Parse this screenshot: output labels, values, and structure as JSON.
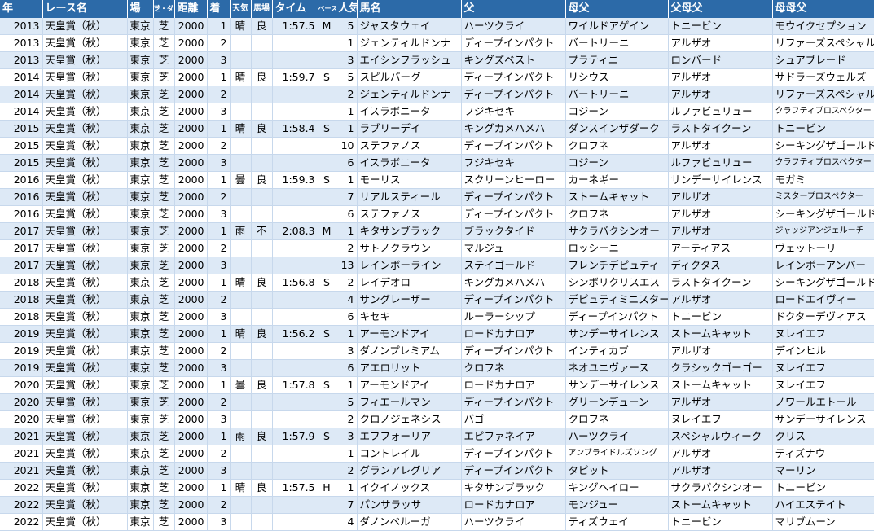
{
  "headers": [
    "年",
    "レース名",
    "場",
    "芝・ダ",
    "距離",
    "着",
    "天気",
    "馬場",
    "タイム",
    "ペース",
    "人気",
    "馬名",
    "父",
    "母父",
    "父母父",
    "母母父"
  ],
  "rows": [
    [
      "2013",
      "天皇賞（秋）",
      "東京",
      "芝",
      "2000",
      "1",
      "晴",
      "良",
      "1:57.5",
      "M",
      "5",
      "ジャスタウェイ",
      "ハーツクライ",
      "ワイルドアゲイン",
      "トニービン",
      "モウイクセプション"
    ],
    [
      "2013",
      "天皇賞（秋）",
      "東京",
      "芝",
      "2000",
      "2",
      "",
      "",
      "",
      "",
      "1",
      "ジェンティルドンナ",
      "ディープインパクト",
      "バートリーニ",
      "アルザオ",
      "リファーズスペシャル"
    ],
    [
      "2013",
      "天皇賞（秋）",
      "東京",
      "芝",
      "2000",
      "3",
      "",
      "",
      "",
      "",
      "3",
      "エイシンフラッシュ",
      "キングズベスト",
      "プラティニ",
      "ロンバード",
      "シュアブレード"
    ],
    [
      "2014",
      "天皇賞（秋）",
      "東京",
      "芝",
      "2000",
      "1",
      "晴",
      "良",
      "1:59.7",
      "S",
      "5",
      "スピルバーグ",
      "ディープインパクト",
      "リシウス",
      "アルザオ",
      "サドラーズウェルズ"
    ],
    [
      "2014",
      "天皇賞（秋）",
      "東京",
      "芝",
      "2000",
      "2",
      "",
      "",
      "",
      "",
      "2",
      "ジェンティルドンナ",
      "ディープインパクト",
      "バートリーニ",
      "アルザオ",
      "リファーズスペシャル"
    ],
    [
      "2014",
      "天皇賞（秋）",
      "東京",
      "芝",
      "2000",
      "3",
      "",
      "",
      "",
      "",
      "1",
      "イスラボニータ",
      "フジキセキ",
      "コジーン",
      "ルファビュリュー",
      "クラフティプロスペクター"
    ],
    [
      "2015",
      "天皇賞（秋）",
      "東京",
      "芝",
      "2000",
      "1",
      "晴",
      "良",
      "1:58.4",
      "S",
      "1",
      "ラブリーデイ",
      "キングカメハメハ",
      "ダンスインザダーク",
      "ラストタイクーン",
      "トニービン"
    ],
    [
      "2015",
      "天皇賞（秋）",
      "東京",
      "芝",
      "2000",
      "2",
      "",
      "",
      "",
      "",
      "10",
      "ステファノス",
      "ディープインパクト",
      "クロフネ",
      "アルザオ",
      "シーキングザゴールド"
    ],
    [
      "2015",
      "天皇賞（秋）",
      "東京",
      "芝",
      "2000",
      "3",
      "",
      "",
      "",
      "",
      "6",
      "イスラボニータ",
      "フジキセキ",
      "コジーン",
      "ルファビュリュー",
      "クラフティプロスペクター"
    ],
    [
      "2016",
      "天皇賞（秋）",
      "東京",
      "芝",
      "2000",
      "1",
      "曇",
      "良",
      "1:59.3",
      "S",
      "1",
      "モーリス",
      "スクリーンヒーロー",
      "カーネギー",
      "サンデーサイレンス",
      "モガミ"
    ],
    [
      "2016",
      "天皇賞（秋）",
      "東京",
      "芝",
      "2000",
      "2",
      "",
      "",
      "",
      "",
      "7",
      "リアルスティール",
      "ディープインパクト",
      "ストームキャット",
      "アルザオ",
      "ミスタープロスペクター"
    ],
    [
      "2016",
      "天皇賞（秋）",
      "東京",
      "芝",
      "2000",
      "3",
      "",
      "",
      "",
      "",
      "6",
      "ステファノス",
      "ディープインパクト",
      "クロフネ",
      "アルザオ",
      "シーキングザゴールド"
    ],
    [
      "2017",
      "天皇賞（秋）",
      "東京",
      "芝",
      "2000",
      "1",
      "雨",
      "不",
      "2:08.3",
      "M",
      "1",
      "キタサンブラック",
      "ブラックタイド",
      "サクラバクシンオー",
      "アルザオ",
      "ジャッジアンジェルーチ"
    ],
    [
      "2017",
      "天皇賞（秋）",
      "東京",
      "芝",
      "2000",
      "2",
      "",
      "",
      "",
      "",
      "2",
      "サトノクラウン",
      "マルジュ",
      "ロッシーニ",
      "アーティアス",
      "ヴェットーリ"
    ],
    [
      "2017",
      "天皇賞（秋）",
      "東京",
      "芝",
      "2000",
      "3",
      "",
      "",
      "",
      "",
      "13",
      "レインボーライン",
      "ステイゴールド",
      "フレンチデピュティ",
      "ディクタス",
      "レインボーアンバー"
    ],
    [
      "2018",
      "天皇賞（秋）",
      "東京",
      "芝",
      "2000",
      "1",
      "晴",
      "良",
      "1:56.8",
      "S",
      "2",
      "レイデオロ",
      "キングカメハメハ",
      "シンボリクリスエス",
      "ラストタイクーン",
      "シーキングザゴールド"
    ],
    [
      "2018",
      "天皇賞（秋）",
      "東京",
      "芝",
      "2000",
      "2",
      "",
      "",
      "",
      "",
      "4",
      "サングレーザー",
      "ディープインパクト",
      "デピュティミニスター",
      "アルザオ",
      "ロードエイヴィー"
    ],
    [
      "2018",
      "天皇賞（秋）",
      "東京",
      "芝",
      "2000",
      "3",
      "",
      "",
      "",
      "",
      "6",
      "キセキ",
      "ルーラーシップ",
      "ディープインパクト",
      "トニービン",
      "ドクターデヴィアス"
    ],
    [
      "2019",
      "天皇賞（秋）",
      "東京",
      "芝",
      "2000",
      "1",
      "晴",
      "良",
      "1:56.2",
      "S",
      "1",
      "アーモンドアイ",
      "ロードカナロア",
      "サンデーサイレンス",
      "ストームキャット",
      "ヌレイエフ"
    ],
    [
      "2019",
      "天皇賞（秋）",
      "東京",
      "芝",
      "2000",
      "2",
      "",
      "",
      "",
      "",
      "3",
      "ダノンプレミアム",
      "ディープインパクト",
      "インティカブ",
      "アルザオ",
      "デインヒル"
    ],
    [
      "2019",
      "天皇賞（秋）",
      "東京",
      "芝",
      "2000",
      "3",
      "",
      "",
      "",
      "",
      "6",
      "アエロリット",
      "クロフネ",
      "ネオユニヴァース",
      "クラシックゴーゴー",
      "ヌレイエフ"
    ],
    [
      "2020",
      "天皇賞（秋）",
      "東京",
      "芝",
      "2000",
      "1",
      "曇",
      "良",
      "1:57.8",
      "S",
      "1",
      "アーモンドアイ",
      "ロードカナロア",
      "サンデーサイレンス",
      "ストームキャット",
      "ヌレイエフ"
    ],
    [
      "2020",
      "天皇賞（秋）",
      "東京",
      "芝",
      "2000",
      "2",
      "",
      "",
      "",
      "",
      "5",
      "フィエールマン",
      "ディープインパクト",
      "グリーンデューン",
      "アルザオ",
      "ノワールエトール"
    ],
    [
      "2020",
      "天皇賞（秋）",
      "東京",
      "芝",
      "2000",
      "3",
      "",
      "",
      "",
      "",
      "2",
      "クロノジェネシス",
      "バゴ",
      "クロフネ",
      "ヌレイエフ",
      "サンデーサイレンス"
    ],
    [
      "2021",
      "天皇賞（秋）",
      "東京",
      "芝",
      "2000",
      "1",
      "雨",
      "良",
      "1:57.9",
      "S",
      "3",
      "エフフォーリア",
      "エピファネイア",
      "ハーツクライ",
      "スペシャルウィーク",
      "クリス"
    ],
    [
      "2021",
      "天皇賞（秋）",
      "東京",
      "芝",
      "2000",
      "2",
      "",
      "",
      "",
      "",
      "1",
      "コントレイル",
      "ディープインパクト",
      "アンブライドルズソング",
      "アルザオ",
      "ティズナウ"
    ],
    [
      "2021",
      "天皇賞（秋）",
      "東京",
      "芝",
      "2000",
      "3",
      "",
      "",
      "",
      "",
      "2",
      "グランアレグリア",
      "ディープインパクト",
      "タピット",
      "アルザオ",
      "マーリン"
    ],
    [
      "2022",
      "天皇賞（秋）",
      "東京",
      "芝",
      "2000",
      "1",
      "晴",
      "良",
      "1:57.5",
      "H",
      "1",
      "イクイノックス",
      "キタサンブラック",
      "キングヘイロー",
      "サクラバクシンオー",
      "トニービン"
    ],
    [
      "2022",
      "天皇賞（秋）",
      "東京",
      "芝",
      "2000",
      "2",
      "",
      "",
      "",
      "",
      "7",
      "パンサラッサ",
      "ロードカナロア",
      "モンジュー",
      "ストームキャット",
      "ハイエステイト"
    ],
    [
      "2022",
      "天皇賞（秋）",
      "東京",
      "芝",
      "2000",
      "3",
      "",
      "",
      "",
      "",
      "4",
      "ダノンベルーガ",
      "ハーツクライ",
      "ティズウェイ",
      "トニービン",
      "マリブムーン"
    ]
  ]
}
